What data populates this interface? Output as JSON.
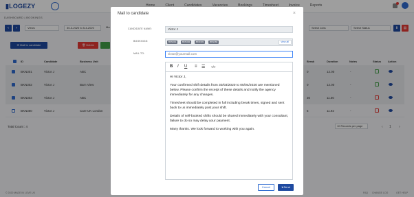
{
  "header": {
    "logo": "LOGEZY",
    "nav": [
      "Home",
      "Client",
      "Candidates",
      "Vacancies",
      "Bookings",
      "Timesheet",
      "Invoice",
      "Reports"
    ]
  },
  "breadcrumb": "DASHBOARD | BOOKINGS",
  "filters": {
    "view": "Views",
    "date_from": "30-3-2020 to 5-4-2020",
    "ma": "Ma",
    "select_jobs": "Select Jobs",
    "select_status": "Select Status"
  },
  "actions": {
    "mail_to_candidate": "Mail to candidate",
    "delete": "Delete"
  },
  "table": {
    "headers": [
      "ID",
      "Candidate",
      "Business Unit",
      "Break",
      "Duration",
      "Notes",
      "Status",
      "Action"
    ],
    "rows": [
      {
        "id": "BKN301",
        "candidate": "Victor J",
        "unit": "ABC",
        "break": "0",
        "duration": "12.00",
        "notes": "-",
        "checked": true
      },
      {
        "id": "BKN302",
        "candidate": "Victor J",
        "unit": "Barn View",
        "break": "0",
        "duration": "12.00",
        "notes": "-",
        "checked": true
      },
      {
        "id": "BKN303",
        "candidate": "Victor J",
        "unit": "ABC",
        "break": "30",
        "duration": "11.50",
        "notes": "-",
        "checked": true
      },
      {
        "id": "BKN360",
        "candidate": "Victor J",
        "unit": "Care UK London",
        "break": "5",
        "duration": "11.92",
        "notes": "-",
        "checked": false
      }
    ],
    "total": "Total Count : 4",
    "per_page": "10 Records per page",
    "page": "1"
  },
  "footer": {
    "left": "© 2020 MADE IN LOVE UK",
    "links": [
      "FAQ",
      "CHANGE LOG",
      "GET HELP"
    ]
  },
  "modal": {
    "title": "Mail to candidate",
    "close": "×",
    "candidate_label": "CANDIDATE NAME:",
    "candidate_value": "Victor J",
    "bookings_label": "BOOKINGS:",
    "bookings": [
      "BKN301",
      "BKN302",
      "BKN303",
      "BKN360"
    ],
    "view_all": "view all",
    "mailto_label": "MAIL TO:",
    "mailto_value": "victor@yourmail.com",
    "toolbar": [
      "B",
      "I",
      "U",
      "≡",
      "☰",
      "</>"
    ],
    "body": [
      "Hi Victor J,",
      "Your confirmed shift details from 30/03/2020 to 05/04/2020 are mentioned below. Please confirm the receipt of these details and notify the agency immediately for any changes.",
      "Timesheet should be completed in full including break times, signed and sent back to us immediately post your shift.",
      "Details of self-booked shifts should be shared immediately with your consultant, failure to do so may delay your payment.",
      "Many thanks. We look forward to working with you again."
    ],
    "cancel": "Cancel",
    "send": "Send"
  },
  "colors": {
    "primary": "#1f4aa0",
    "danger": "#e53935",
    "success": "#43a047"
  }
}
